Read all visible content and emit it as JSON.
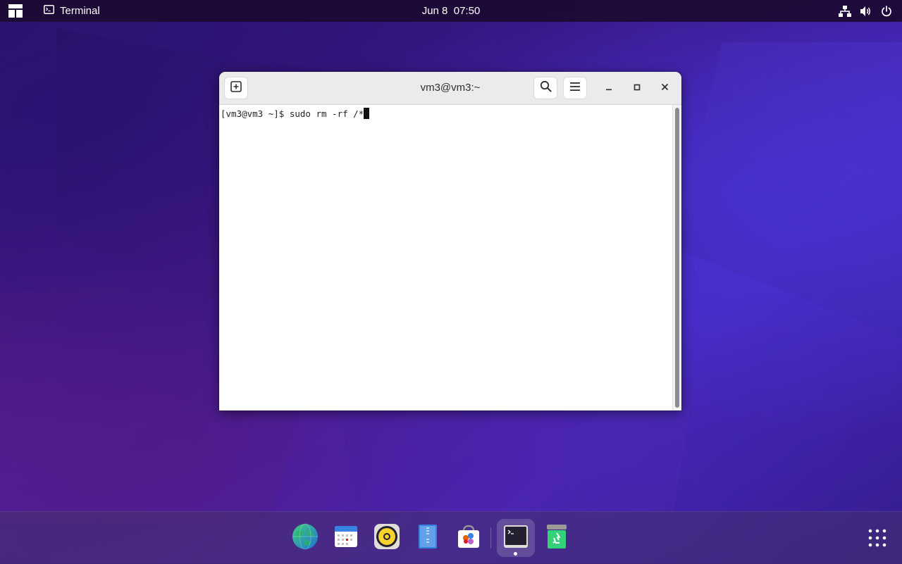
{
  "topbar": {
    "app_name": "Terminal",
    "date": "Jun 8",
    "time": "07:50",
    "icons": [
      "activities-icon",
      "terminal-app-icon",
      "network-icon",
      "volume-icon",
      "power-icon"
    ]
  },
  "window": {
    "title": "vm3@vm3:~",
    "new_tab_icon": "new-tab-icon",
    "search_icon": "search-icon",
    "menu_icon": "hamburger-menu-icon",
    "minimize_icon": "minimize-icon",
    "maximize_icon": "maximize-icon",
    "close_icon": "close-icon"
  },
  "terminal": {
    "prompt": "[vm3@vm3 ~]$ ",
    "command": "sudo rm -rf /*"
  },
  "dock": {
    "items": [
      {
        "name": "web-browser",
        "icon": "globe-icon"
      },
      {
        "name": "calendar",
        "icon": "calendar-icon"
      },
      {
        "name": "music-player",
        "icon": "speaker-icon"
      },
      {
        "name": "file-archiver",
        "icon": "archive-icon"
      },
      {
        "name": "software-store",
        "icon": "shopping-bag-icon"
      },
      {
        "name": "terminal",
        "icon": "terminal-icon",
        "active": true
      },
      {
        "name": "trash",
        "icon": "trash-icon"
      }
    ],
    "app_grid_icon": "app-grid-icon"
  },
  "colors": {
    "topbar_bg": "#1c0a32",
    "window_header": "#ebebeb",
    "terminal_bg": "#ffffff",
    "wallpaper_primary": "#3c1a86",
    "wallpaper_accent": "#4a3ae0"
  }
}
